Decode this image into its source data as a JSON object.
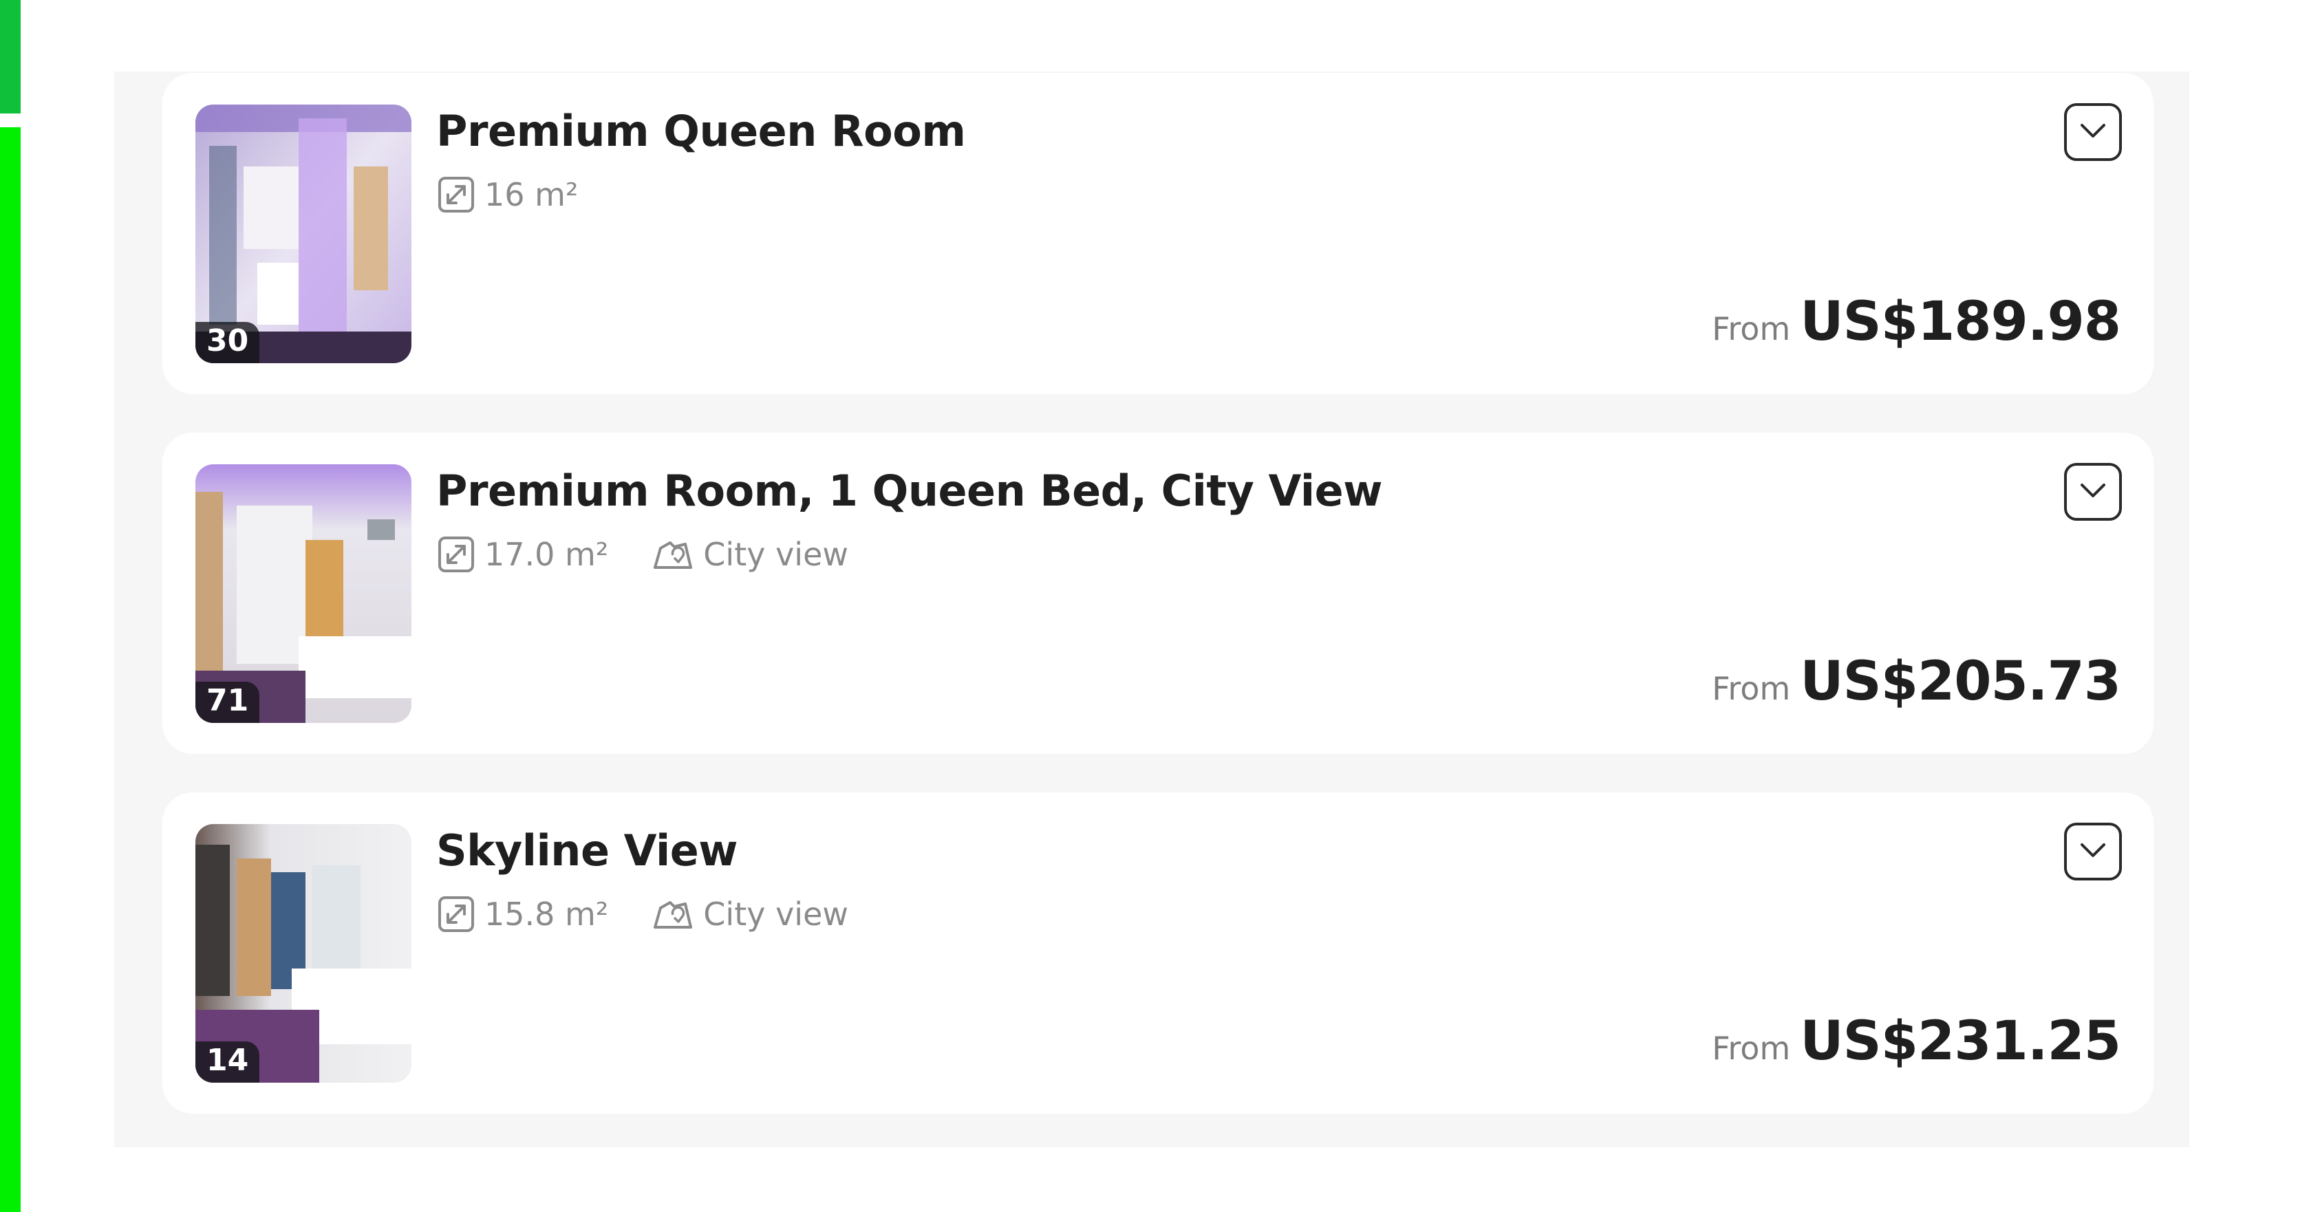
{
  "rooms": [
    {
      "title": "Premium Queen Room",
      "photo_count": "30",
      "size": "16 m²",
      "view": "",
      "from_label": "From",
      "price": "US$189.98"
    },
    {
      "title": "Premium Room, 1 Queen Bed, City View",
      "photo_count": "71",
      "size": "17.0 m²",
      "view": "City view",
      "from_label": "From",
      "price": "US$205.73"
    },
    {
      "title": "Skyline View",
      "photo_count": "14",
      "size": "15.8 m²",
      "view": "City view",
      "from_label": "From",
      "price": "US$231.25"
    }
  ],
  "icons": {
    "size": "resize-arrow-icon",
    "view": "city-view-icon",
    "expand": "chevron-down-icon"
  },
  "colors": {
    "accent_green_top": "#0fc03a",
    "accent_green": "#00f000",
    "panel_bg": "#f6f6f6",
    "card_bg": "#ffffff",
    "text_primary": "#1f1f1f",
    "text_muted": "#8a8a8a"
  }
}
